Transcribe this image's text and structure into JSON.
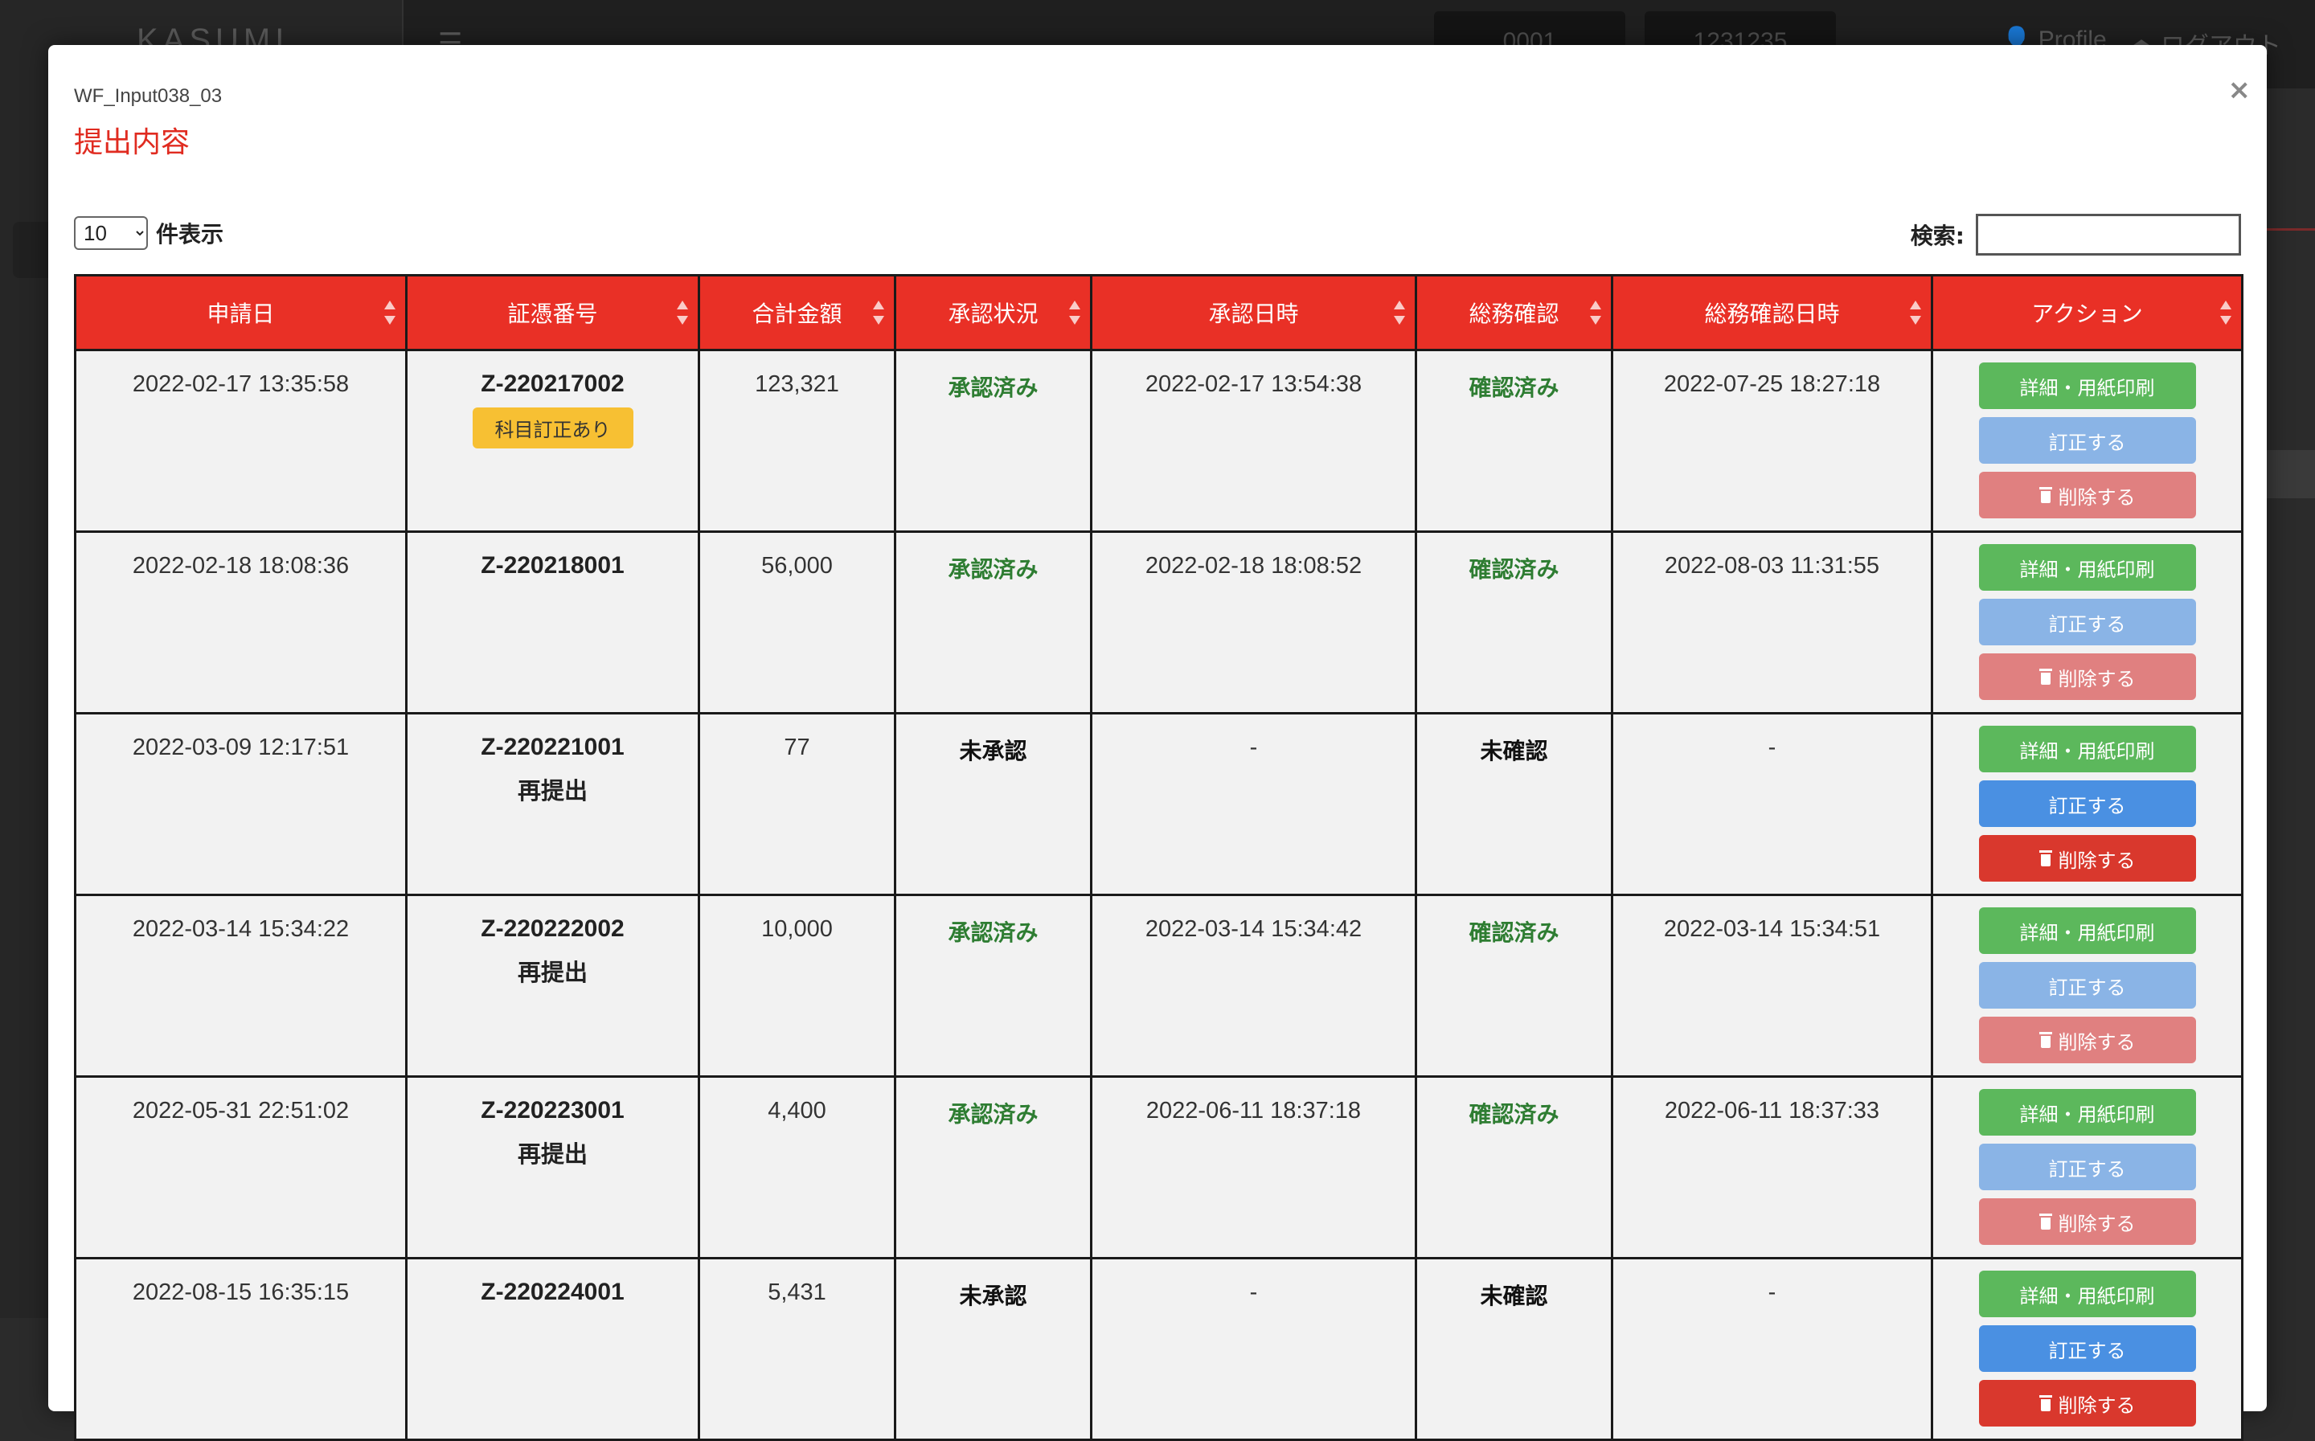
{
  "background": {
    "logo": "KASUMI",
    "menu_icon": "hamburger-icon",
    "code_pill_1": "0001",
    "code_pill_2": "1231235",
    "profile_label": "Profile",
    "logout_label": "ログアウト"
  },
  "modal": {
    "code": "WF_Input038_03",
    "title": "提出内容",
    "close_label": "×"
  },
  "controls": {
    "page_length": "10",
    "page_length_label": "件表示",
    "search_label": "検索:",
    "search_value": ""
  },
  "table": {
    "headers": [
      "申請日",
      "証憑番号",
      "合計金額",
      "承認状況",
      "承認日時",
      "総務確認",
      "総務確認日時",
      "アクション"
    ],
    "buttons": {
      "detail": "詳細・用紙印刷",
      "edit": "訂正する",
      "delete": "削除する"
    },
    "rows": [
      {
        "date": "2022-02-17 13:35:58",
        "voucher": "Z-220217002",
        "badge": "科目訂正あり",
        "note": "",
        "amount": "123,321",
        "approval": "承認済み",
        "approval_at": "2022-02-17 13:54:38",
        "confirm": "確認済み",
        "confirm_at": "2022-07-25 18:27:18"
      },
      {
        "date": "2022-02-18 18:08:36",
        "voucher": "Z-220218001",
        "badge": "",
        "note": "",
        "amount": "56,000",
        "approval": "承認済み",
        "approval_at": "2022-02-18 18:08:52",
        "confirm": "確認済み",
        "confirm_at": "2022-08-03 11:31:55"
      },
      {
        "date": "2022-03-09 12:17:51",
        "voucher": "Z-220221001",
        "badge": "",
        "note": "再提出",
        "amount": "77",
        "approval": "未承認",
        "approval_at": "-",
        "confirm": "未確認",
        "confirm_at": "-"
      },
      {
        "date": "2022-03-14 15:34:22",
        "voucher": "Z-220222002",
        "badge": "",
        "note": "再提出",
        "amount": "10,000",
        "approval": "承認済み",
        "approval_at": "2022-03-14 15:34:42",
        "confirm": "確認済み",
        "confirm_at": "2022-03-14 15:34:51"
      },
      {
        "date": "2022-05-31 22:51:02",
        "voucher": "Z-220223001",
        "badge": "",
        "note": "再提出",
        "amount": "4,400",
        "approval": "承認済み",
        "approval_at": "2022-06-11 18:37:18",
        "confirm": "確認済み",
        "confirm_at": "2022-06-11 18:37:33"
      },
      {
        "date": "2022-08-15 16:35:15",
        "voucher": "Z-220224001",
        "badge": "",
        "note": "",
        "amount": "5,431",
        "approval": "未承認",
        "approval_at": "-",
        "confirm": "未確認",
        "confirm_at": "-"
      }
    ]
  },
  "colors": {
    "header_red": "#e93026",
    "title_red": "#e02b20",
    "approved_green": "#2e7d32",
    "detail_green": "#5cb85c",
    "edit_blue": "#4a90e2",
    "delete_red": "#d9382d",
    "badge_yellow": "#f7c033"
  }
}
